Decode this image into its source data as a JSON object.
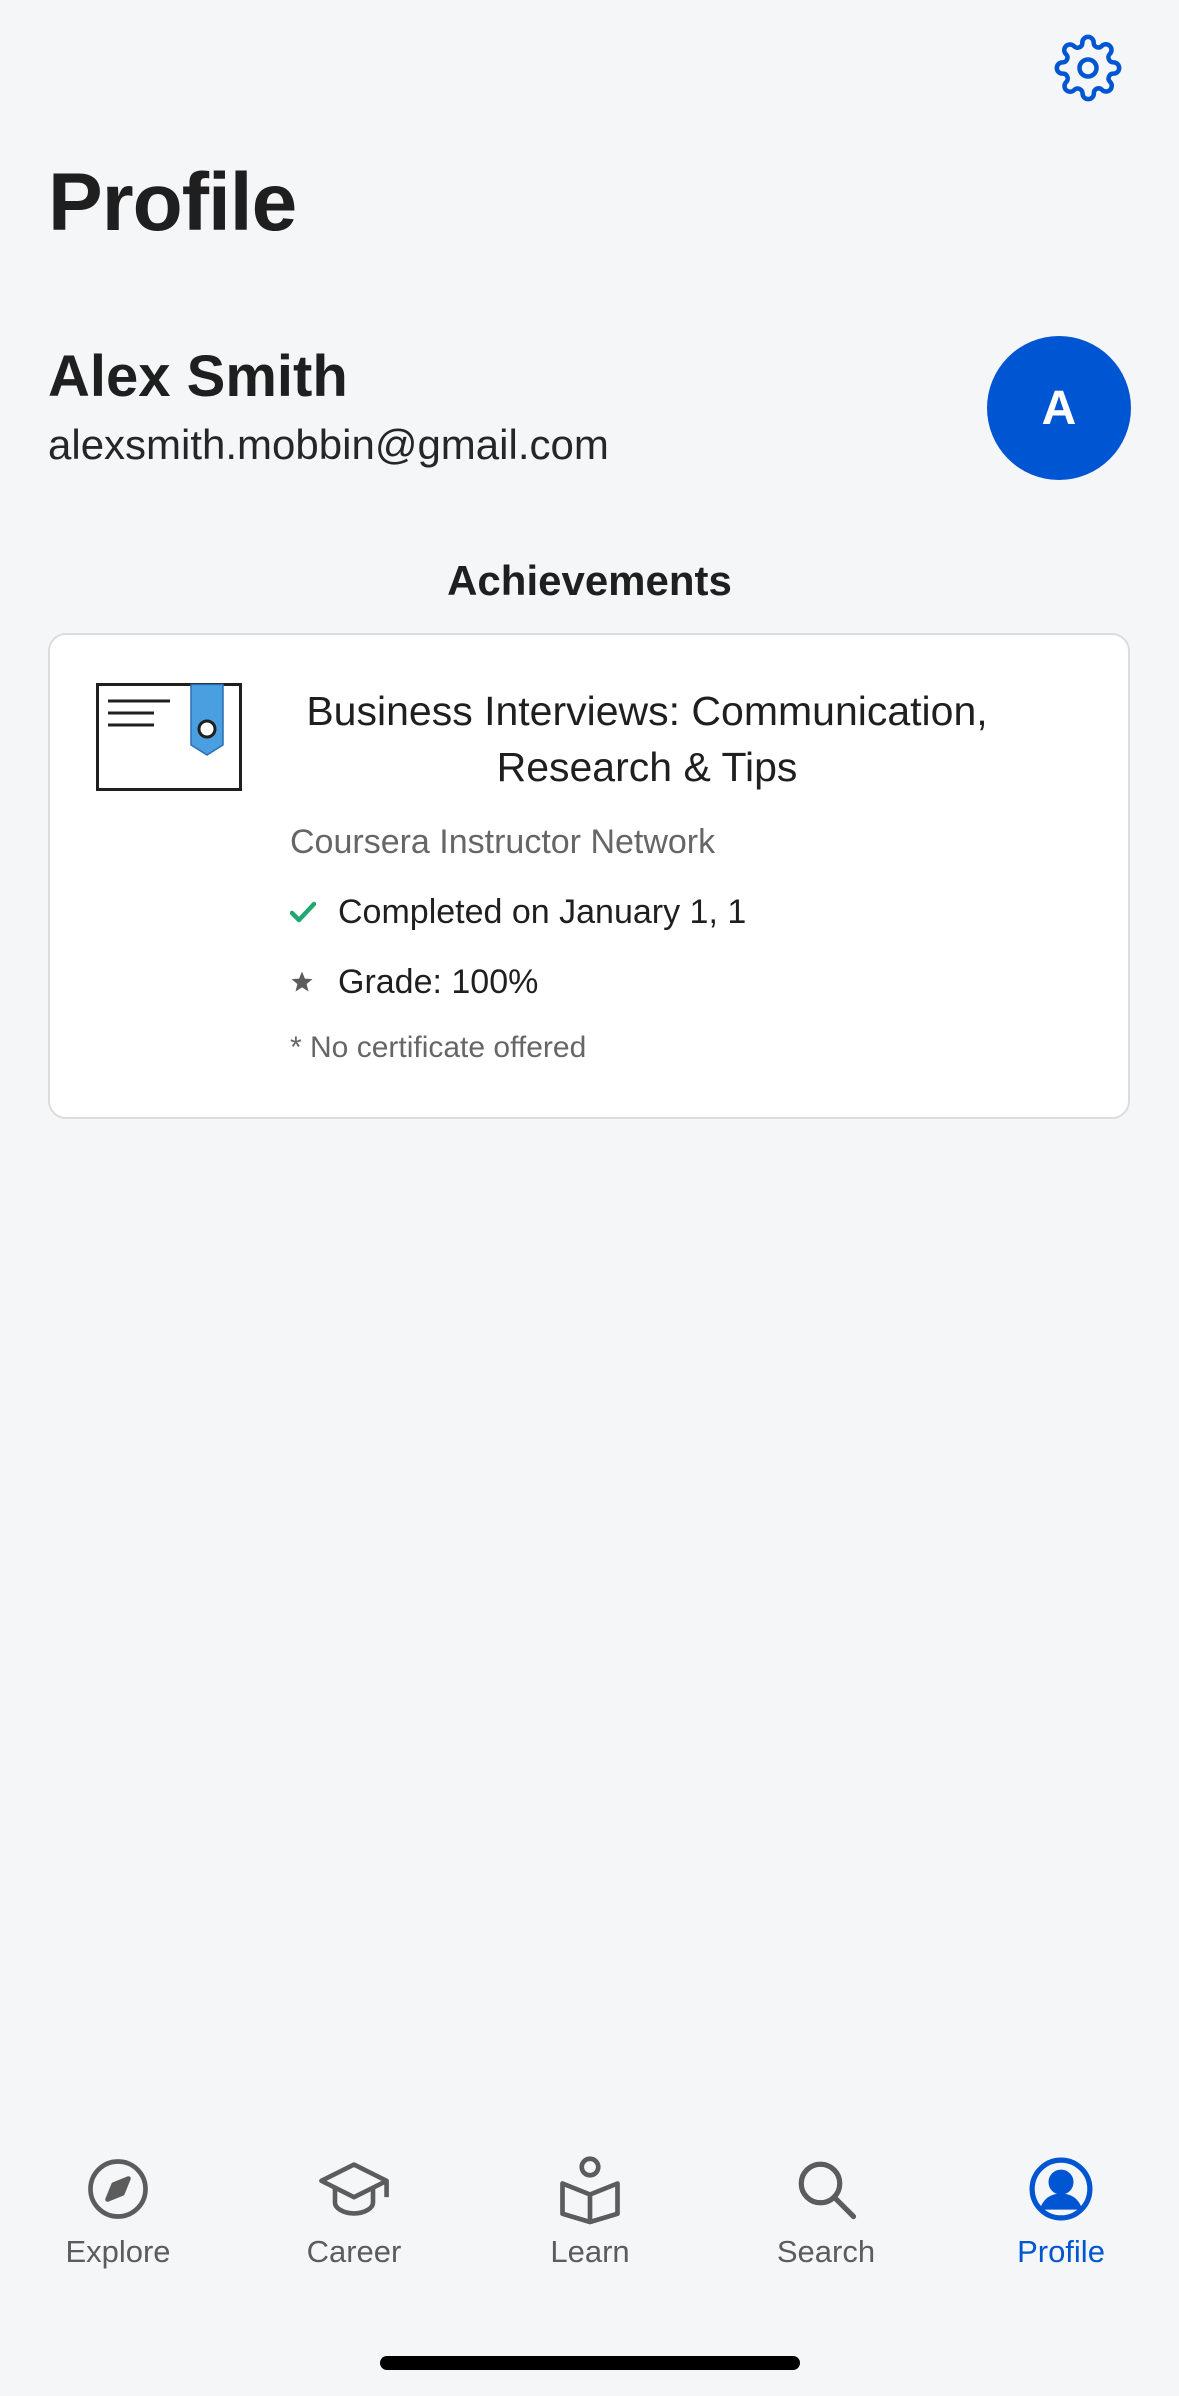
{
  "header": {
    "title": "Profile",
    "settings_icon": "gear-icon"
  },
  "user": {
    "name": "Alex Smith",
    "email": "alexsmith.mobbin@gmail.com",
    "avatar_initial": "A"
  },
  "achievements": {
    "heading": "Achievements",
    "items": [
      {
        "icon": "certificate-icon",
        "title": "Business Interviews: Communication, Research & Tips",
        "partner": "Coursera Instructor Network",
        "completed": "Completed on January 1, 1",
        "grade": "Grade: 100%",
        "note": "* No certificate offered"
      }
    ]
  },
  "tabbar": {
    "items": [
      {
        "label": "Explore",
        "icon": "compass-icon"
      },
      {
        "label": "Career",
        "icon": "graduation-cap-icon"
      },
      {
        "label": "Learn",
        "icon": "learner-book-icon"
      },
      {
        "label": "Search",
        "icon": "search-icon"
      },
      {
        "label": "Profile",
        "icon": "user-circle-icon",
        "active": true
      }
    ]
  },
  "colors": {
    "accent": "#0056d2",
    "background": "#f5f6f8",
    "check": "#1fa971",
    "muted_text": "#666666"
  }
}
